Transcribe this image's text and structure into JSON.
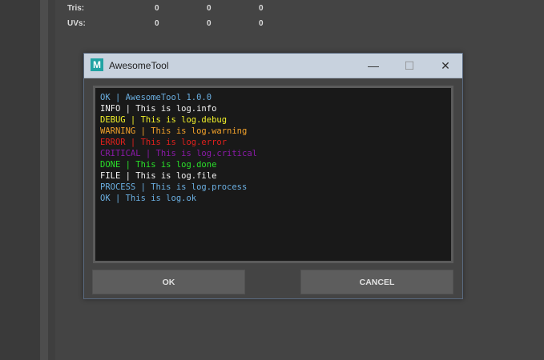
{
  "stats": [
    {
      "label": "Tris:",
      "values": [
        "0",
        "0",
        "0"
      ]
    },
    {
      "label": "UVs:",
      "values": [
        "0",
        "0",
        "0"
      ]
    }
  ],
  "dialog": {
    "icon_letter": "M",
    "title": "AwesomeTool",
    "min_glyph": "—",
    "max_glyph": "☐",
    "close_glyph": "✕",
    "log_lines": [
      {
        "text": "OK | AwesomeTool 1.0.0",
        "color": "#6aaee0"
      },
      {
        "text": "INFO | This is log.info",
        "color": "#f2f2f2"
      },
      {
        "text": "DEBUG | This is log.debug",
        "color": "#f2f22a"
      },
      {
        "text": "WARNING | This is log.warning",
        "color": "#f2a12a"
      },
      {
        "text": "ERROR | This is log.error",
        "color": "#e0201c"
      },
      {
        "text": "CRITICAL | This is log.critical",
        "color": "#8a1aa8"
      },
      {
        "text": "DONE | This is log.done",
        "color": "#2ae02a"
      },
      {
        "text": "FILE | This is log.file",
        "color": "#f2f2f2"
      },
      {
        "text": "PROCESS | This is log.process",
        "color": "#6aaee0"
      },
      {
        "text": "OK | This is log.ok",
        "color": "#6aaee0"
      }
    ],
    "ok_label": "OK",
    "cancel_label": "CANCEL"
  }
}
